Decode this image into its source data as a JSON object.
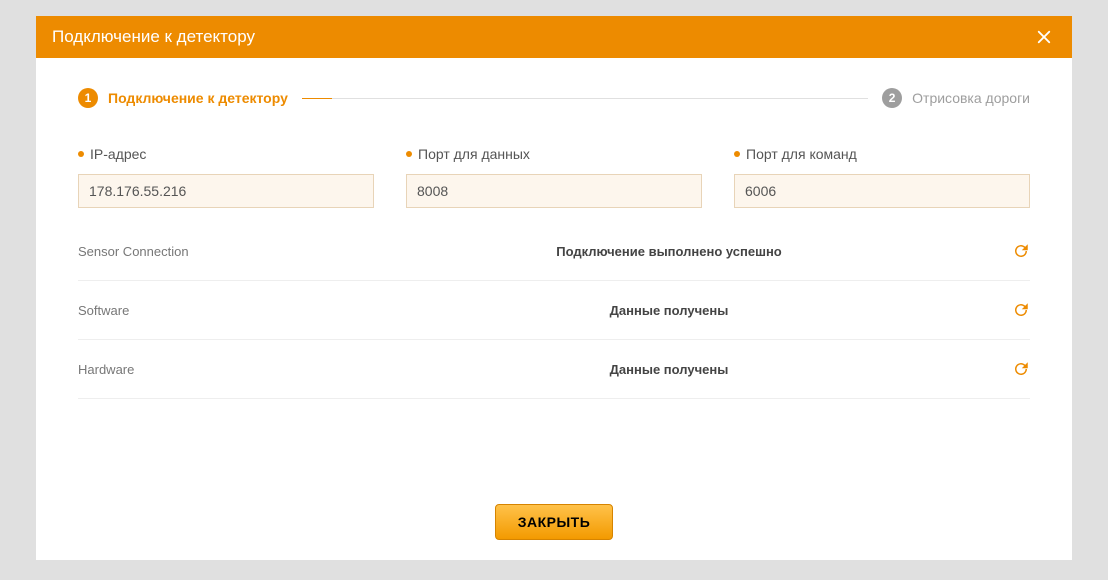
{
  "dialog": {
    "title": "Подключение к детектору",
    "close_button_label": "ЗАКРЫТЬ"
  },
  "wizard": {
    "steps": [
      {
        "num": "1",
        "label": "Подключение к детектору",
        "active": true
      },
      {
        "num": "2",
        "label": "Отрисовка дороги",
        "active": false
      }
    ]
  },
  "fields": {
    "ip": {
      "label": "IP-адрес",
      "value": "178.176.55.216"
    },
    "dataPort": {
      "label": "Порт для данных",
      "value": "8008"
    },
    "cmdPort": {
      "label": "Порт для команд",
      "value": "6006"
    }
  },
  "status": [
    {
      "label": "Sensor Connection",
      "value": "Подключение выполнено успешно"
    },
    {
      "label": "Software",
      "value": "Данные получены"
    },
    {
      "label": "Hardware",
      "value": "Данные получены"
    }
  ],
  "icons": {
    "close": "close-icon",
    "refresh": "refresh-icon"
  }
}
